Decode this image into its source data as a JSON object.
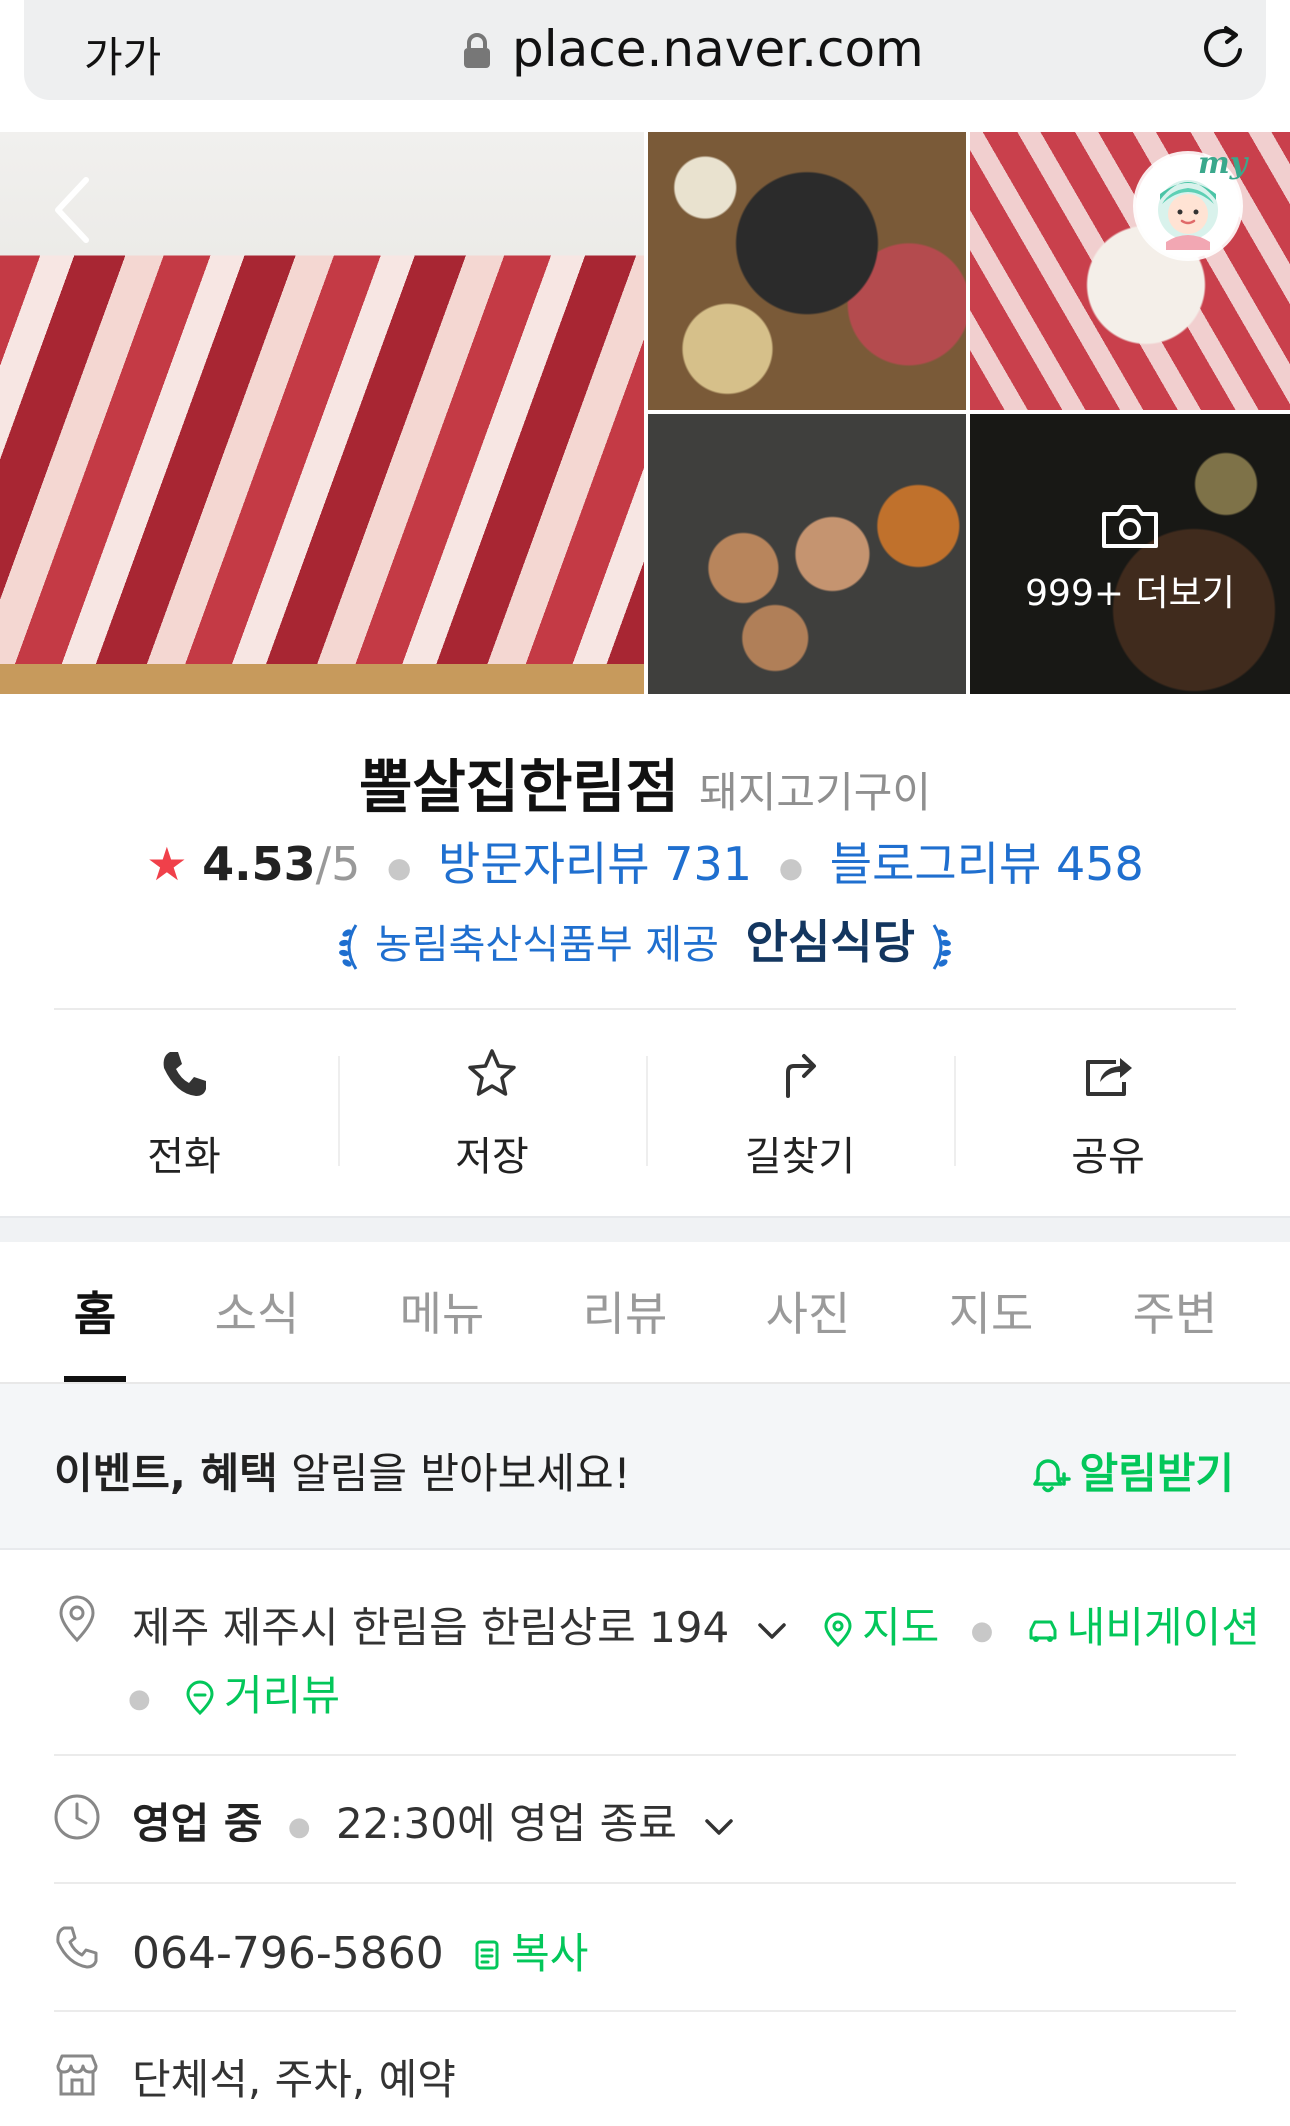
{
  "browser": {
    "text_size_label": "가가",
    "url": "place.naver.com"
  },
  "gallery": {
    "more_label": "999+ 더보기",
    "my_badge": "my"
  },
  "place": {
    "name": "뽈살집한림점",
    "category": "돼지고기구이",
    "rating": "4.53",
    "rating_max": "/5",
    "visitor_review_label": "방문자리뷰 731",
    "blog_review_label": "블로그리뷰 458",
    "cert_provider": "농림축산식품부 제공",
    "cert_name": "안심식당"
  },
  "actions": [
    {
      "label": "전화",
      "icon": "phone-icon"
    },
    {
      "label": "저장",
      "icon": "star-icon"
    },
    {
      "label": "길찾기",
      "icon": "directions-icon"
    },
    {
      "label": "공유",
      "icon": "share-icon"
    }
  ],
  "tabs": [
    {
      "label": "홈",
      "active": true
    },
    {
      "label": "소식"
    },
    {
      "label": "메뉴"
    },
    {
      "label": "리뷰"
    },
    {
      "label": "사진"
    },
    {
      "label": "지도"
    },
    {
      "label": "주변"
    }
  ],
  "event": {
    "bold_text": "이벤트, 혜택",
    "text": " 알림을 받아보세요!",
    "action_label": "알림받기"
  },
  "info": {
    "address": "제주 제주시 한림읍 한림상로 194",
    "map_link": "지도",
    "navigation_link": "내비게이션",
    "street_view_link": "거리뷰",
    "hours_status": "영업 중",
    "hours_detail": "22:30에 영업 종료",
    "phone": "064-796-5860",
    "copy_label": "복사",
    "facilities": "단체석, 주차, 예약"
  },
  "colors": {
    "naver_green": "#03c75a",
    "link_blue": "#1f6fcf",
    "star_red": "#f0404a"
  }
}
